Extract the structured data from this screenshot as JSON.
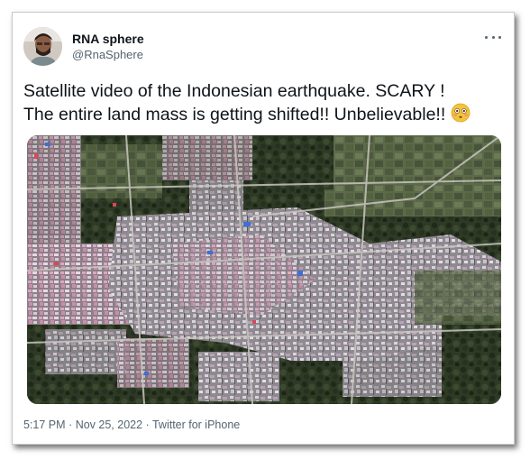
{
  "tweet": {
    "display_name": "RNA sphere",
    "handle": "@RnaSphere",
    "text_line1": "Satellite video of the Indonesian earthquake. SCARY !",
    "text_line2": "The entire land mass is getting shifted!! Unbelievable!!",
    "emoji": "flushed-face-emoji",
    "more_icon": "more-options-icon",
    "time": "5:17 PM",
    "date": "Nov 25, 2022",
    "source": "Twitter for iPhone",
    "separator": "·"
  },
  "colors": {
    "text_primary": "#0f1419",
    "text_secondary": "#536471",
    "frame_border": "#c9c9c9",
    "emoji_yellow": "#f5c33b"
  }
}
